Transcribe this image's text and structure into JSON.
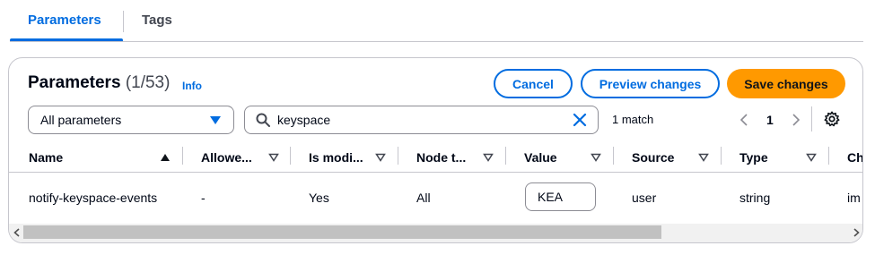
{
  "tabs": [
    {
      "label": "Parameters"
    },
    {
      "label": "Tags"
    }
  ],
  "header": {
    "title": "Parameters",
    "count": "(1/53)",
    "info": "Info"
  },
  "actions": {
    "cancel": "Cancel",
    "preview": "Preview changes",
    "save": "Save changes"
  },
  "filter": {
    "select_value": "All parameters",
    "search_value": "keyspace",
    "match_text": "1 match"
  },
  "pagination": {
    "current_page": "1"
  },
  "table": {
    "columns": [
      "Name",
      "Allowe...",
      "Is modi...",
      "Node t...",
      "Value",
      "Source",
      "Type",
      "Ch"
    ],
    "rows": [
      {
        "name": "notify-keyspace-events",
        "allowed": "-",
        "modifiable": "Yes",
        "node_type": "All",
        "value": "KEA",
        "source": "user",
        "type": "string",
        "changes": "im"
      }
    ]
  },
  "colors": {
    "accent": "#006ce0",
    "primary_button": "#ff9900",
    "border": "#c6c6cd"
  }
}
